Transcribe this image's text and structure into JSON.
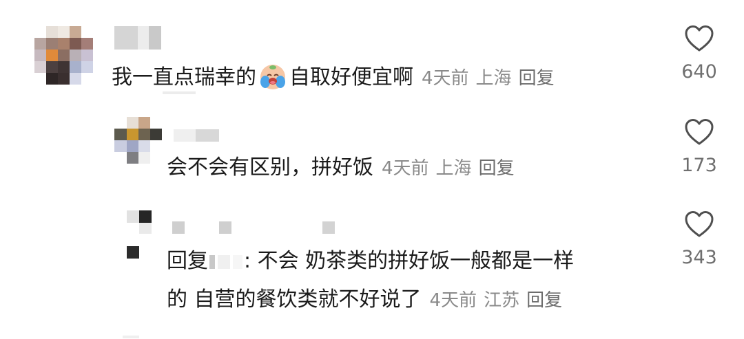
{
  "comments": [
    {
      "text": "我一直点瑞幸的",
      "text_after": "自取好便宜啊",
      "emoji": "crying-face-emoji",
      "time": "4天前",
      "location": "上海",
      "reply_label": "回复",
      "likes": "640"
    },
    {
      "text": "会不会有区别，拼好饭",
      "time": "4天前",
      "location": "上海",
      "reply_label": "回复",
      "likes": "173"
    },
    {
      "reply_prefix": "回复",
      "text_line1": ": 不会 奶茶类的拼好饭一般都是一样",
      "text_line2": "的 自营的餐饮类就不好说了",
      "time": "4天前",
      "location": "江苏",
      "reply_label": "回复",
      "likes": "343"
    }
  ],
  "icons": {
    "like": "heart-outline-icon"
  },
  "colors": {
    "text": "#1b1b1b",
    "meta": "#8a8a8a",
    "like_count": "#6f6f6f"
  }
}
